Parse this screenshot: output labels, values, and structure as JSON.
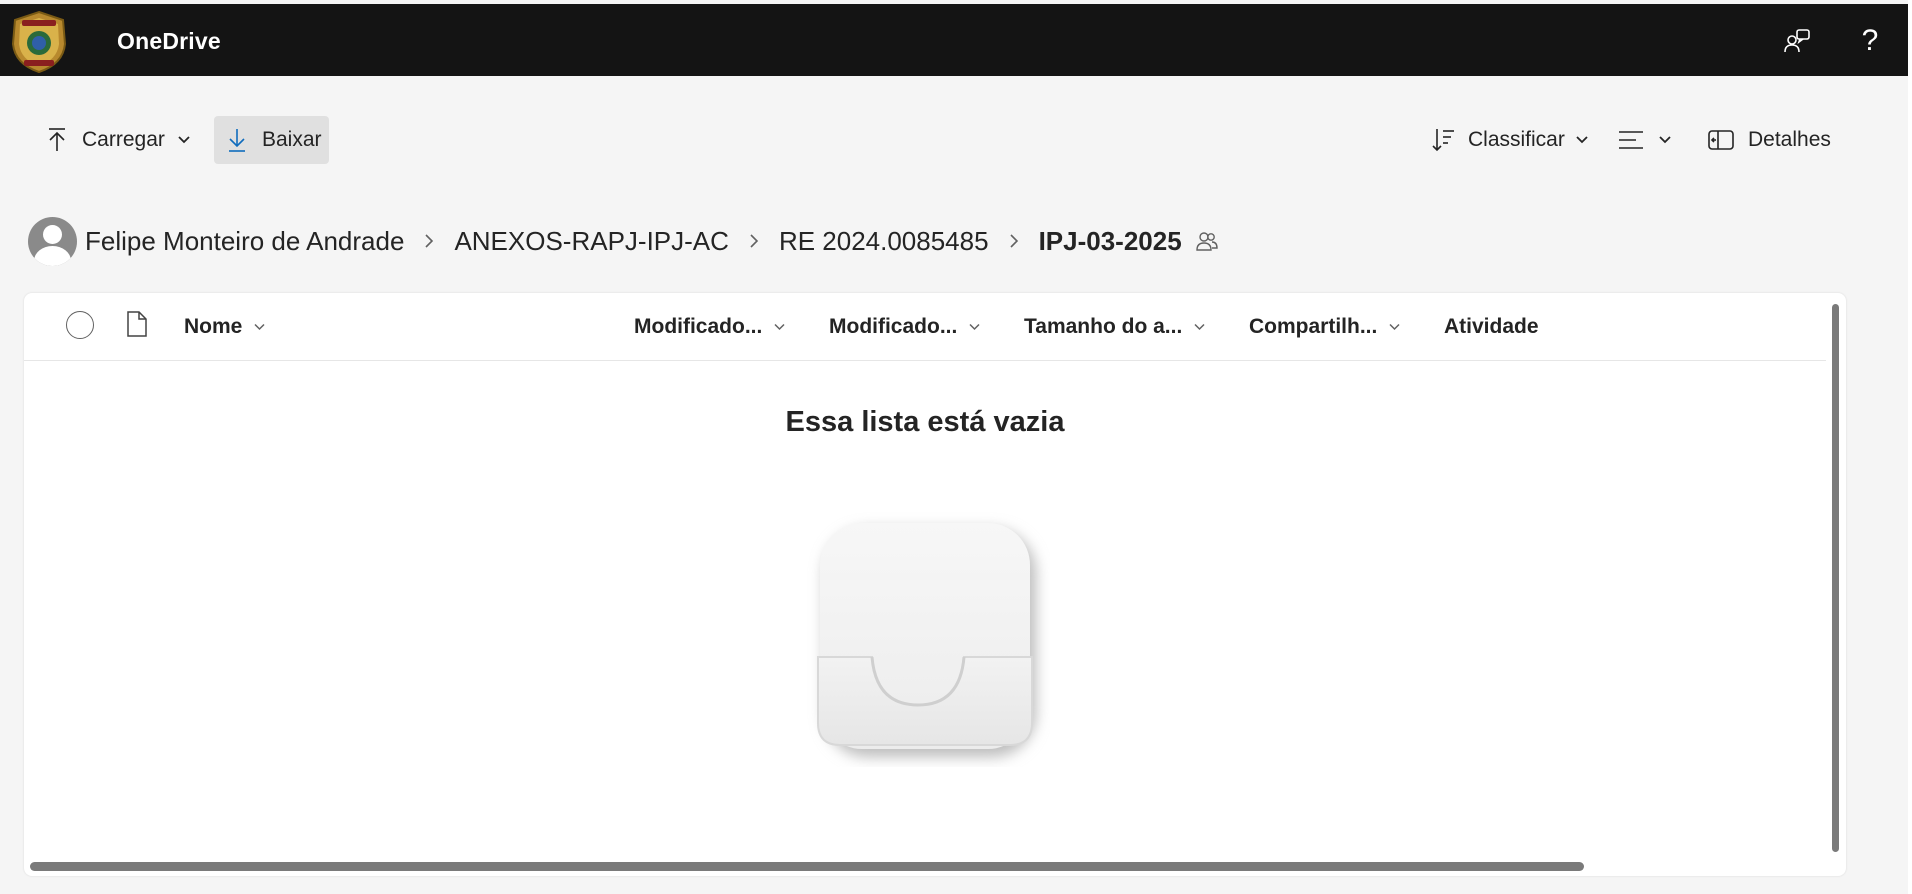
{
  "app": {
    "title": "OneDrive",
    "logo_text": [
      "POLÍCIA",
      "FEDERAL"
    ]
  },
  "topbar": {
    "help_glyph": "?",
    "icons": [
      "feedback-icon",
      "help-icon"
    ]
  },
  "command_bar": {
    "upload_label": "Carregar",
    "download_label": "Baixar",
    "sort_label": "Classificar",
    "details_label": "Detalhes"
  },
  "breadcrumb": {
    "items": [
      "Felipe Monteiro de Andrade",
      "ANEXOS-RAPJ-IPJ-AC",
      "RE 2024.0085485"
    ],
    "current": "IPJ-03-2025"
  },
  "list": {
    "columns": [
      "Nome",
      "Modificado...",
      "Modificado...",
      "Tamanho do a...",
      "Compartilh...",
      "Atividade"
    ],
    "empty_message": "Essa lista está vazia"
  },
  "colors": {
    "topbar": "#141414",
    "background": "#f5f5f5",
    "accent": "#0f6cbd",
    "selected_button": "#e0e0e0"
  }
}
